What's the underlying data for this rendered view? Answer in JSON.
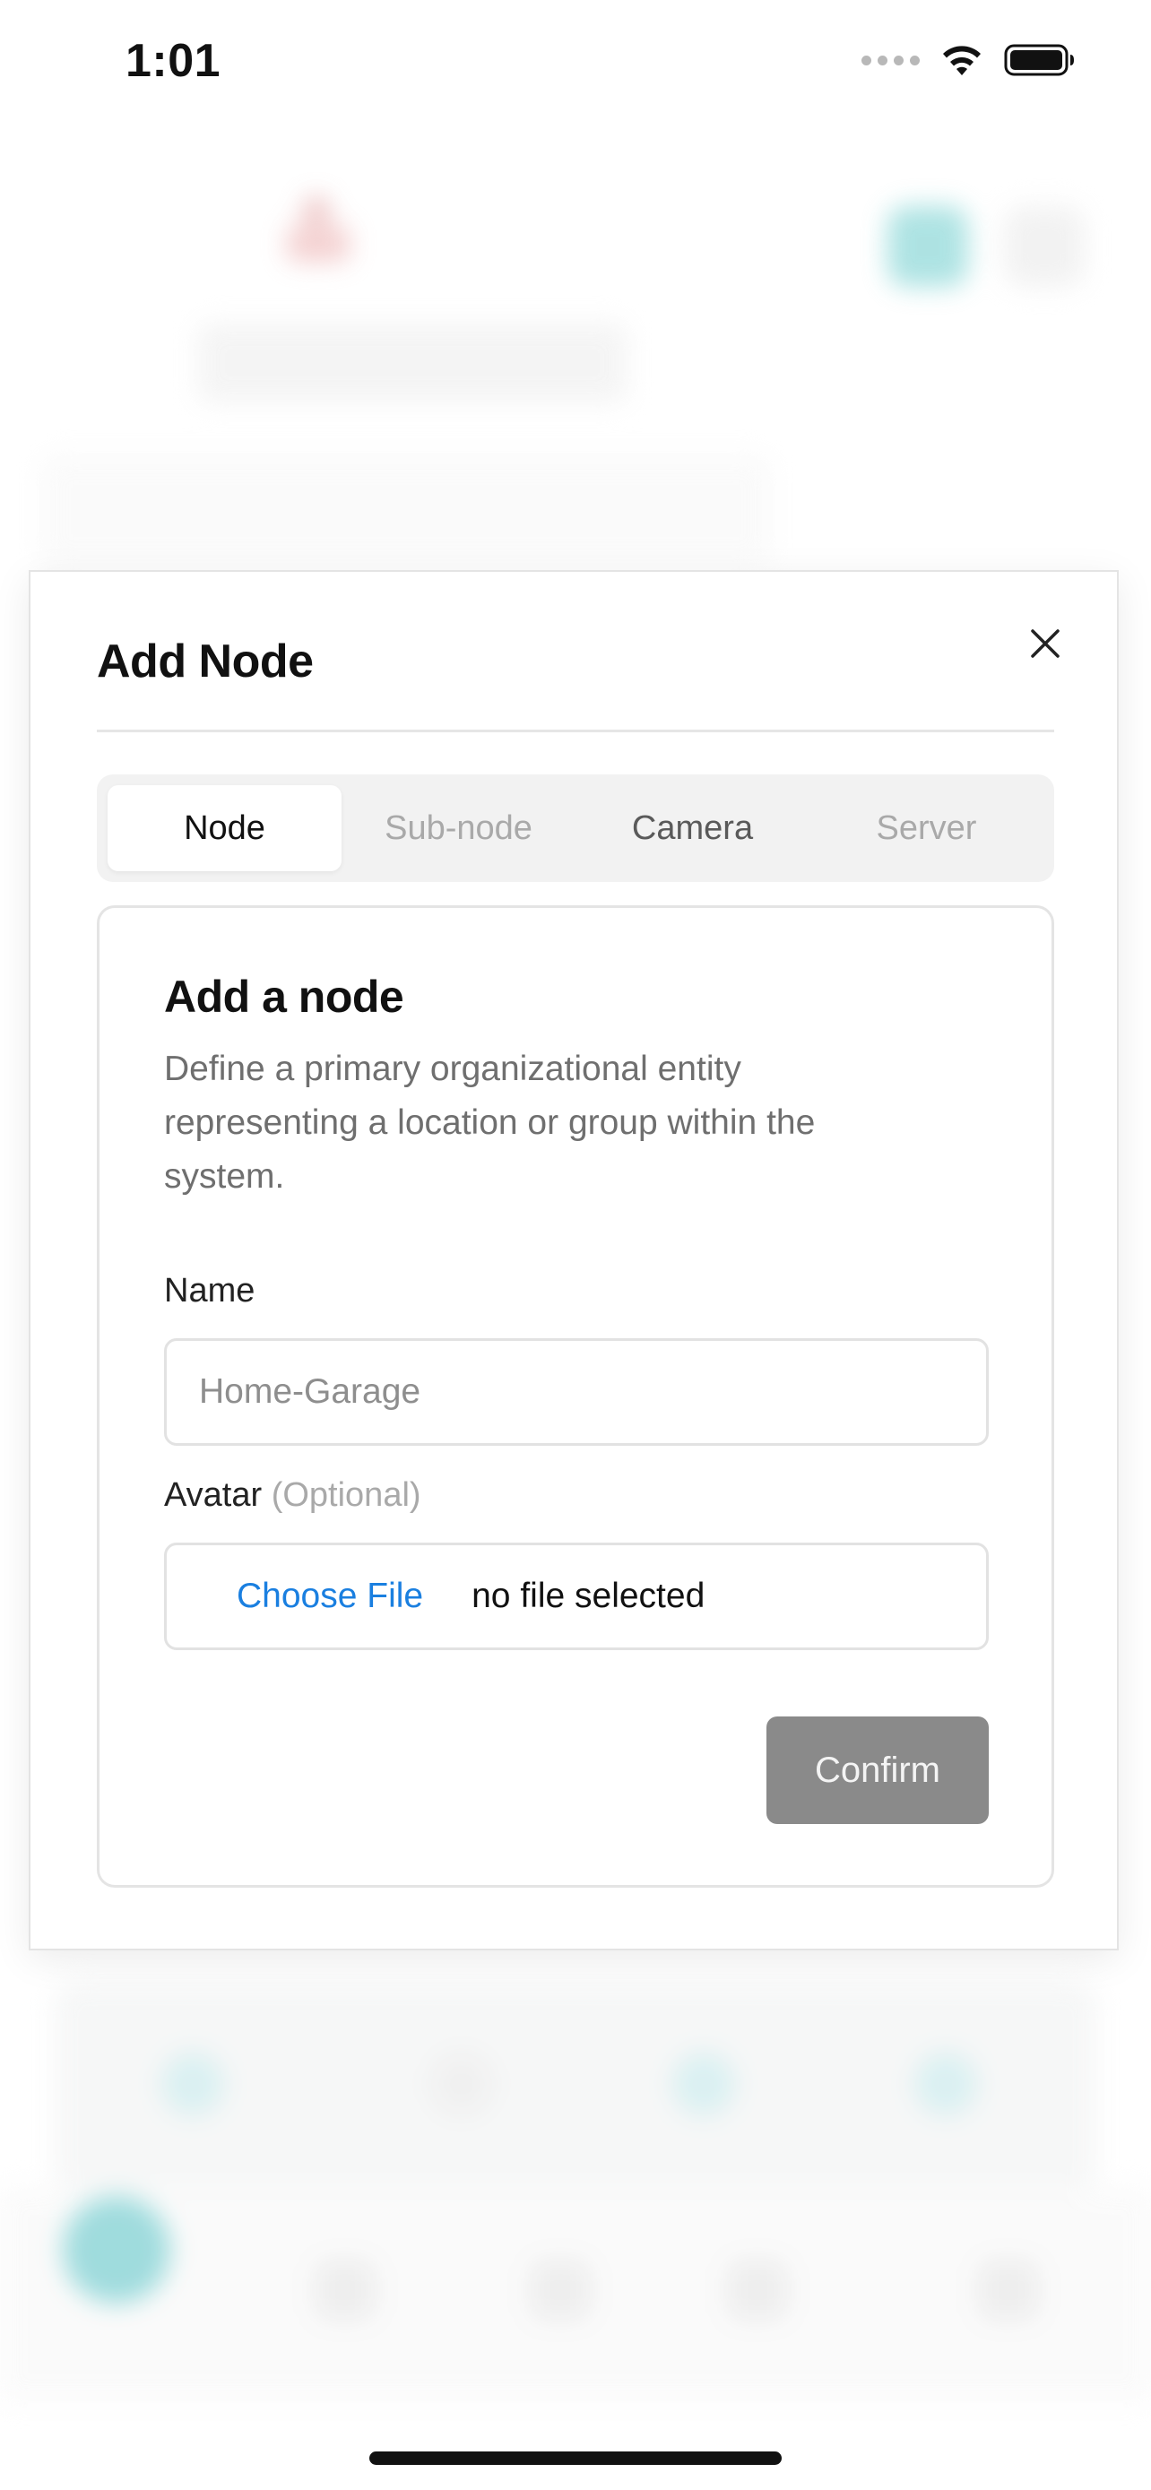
{
  "status_bar": {
    "time": "1:01"
  },
  "modal": {
    "title": "Add Node",
    "tabs": [
      {
        "label": "Node",
        "state": "active"
      },
      {
        "label": "Sub-node",
        "state": "disabled"
      },
      {
        "label": "Camera",
        "state": "inactive"
      },
      {
        "label": "Server",
        "state": "disabled"
      }
    ],
    "card": {
      "title": "Add a node",
      "description": "Define a primary organizational entity representing a location or group within the system.",
      "name_label": "Name",
      "name_placeholder": "Home-Garage",
      "avatar_label": "Avatar",
      "avatar_optional": "(Optional)",
      "choose_file_label": "Choose File",
      "file_status": "no file selected",
      "confirm_label": "Confirm"
    }
  },
  "colors": {
    "accent_link": "#1a7fe0",
    "confirm_disabled": "#8a8a8a",
    "muted_text": "#a9a9a9",
    "background_accent": "#8fd6d8"
  },
  "icons": {
    "close": "close-icon",
    "wifi": "wifi-icon",
    "battery": "battery-icon",
    "signal": "cellular-signal-icon"
  }
}
